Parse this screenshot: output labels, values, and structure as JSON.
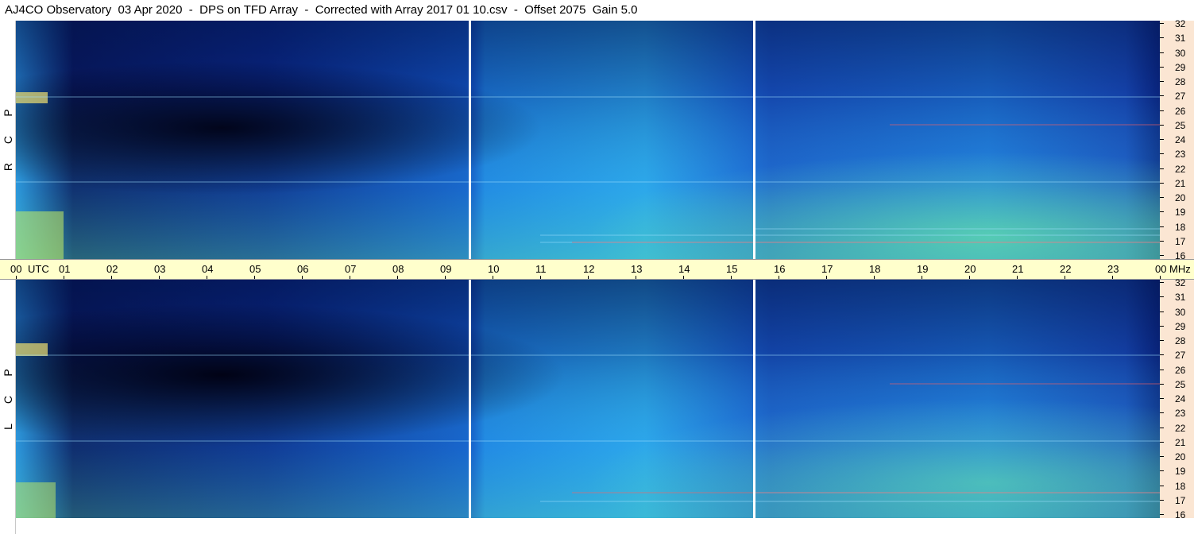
{
  "title": "AJ4CO Observatory  03 Apr 2020  -  DPS on TFD Array  -  Corrected with Array 2017 01 10.csv  -  Offset 2075  Gain 5.0",
  "panels": [
    {
      "id": "rcp",
      "polarization_letters": [
        "R",
        "C",
        "P"
      ]
    },
    {
      "id": "lcp",
      "polarization_letters": [
        "L",
        "C",
        "P"
      ]
    }
  ],
  "time_axis": {
    "labels": [
      "00",
      "UTC",
      "01",
      "02",
      "03",
      "04",
      "05",
      "06",
      "07",
      "08",
      "09",
      "10",
      "11",
      "12",
      "13",
      "14",
      "15",
      "16",
      "17",
      "18",
      "19",
      "20",
      "21",
      "22",
      "23",
      "00",
      "MHz"
    ]
  },
  "frequency_axis": {
    "unit": "MHz",
    "labels": [
      "32",
      "31",
      "30",
      "29",
      "28",
      "27",
      "26",
      "25",
      "24",
      "23",
      "22",
      "21",
      "20",
      "19",
      "18",
      "17",
      "16"
    ]
  },
  "colors": {
    "title_bg": "#ffffff",
    "time_axis_bg": "#ffffcc",
    "freq_axis_bg": "#fbe6d3",
    "spectrogram_deep": "#0a1a5c",
    "spectrogram_mid": "#1f6fe6",
    "spectrogram_hot": "#3fd0b8",
    "gap_line": "#ffffff"
  }
}
